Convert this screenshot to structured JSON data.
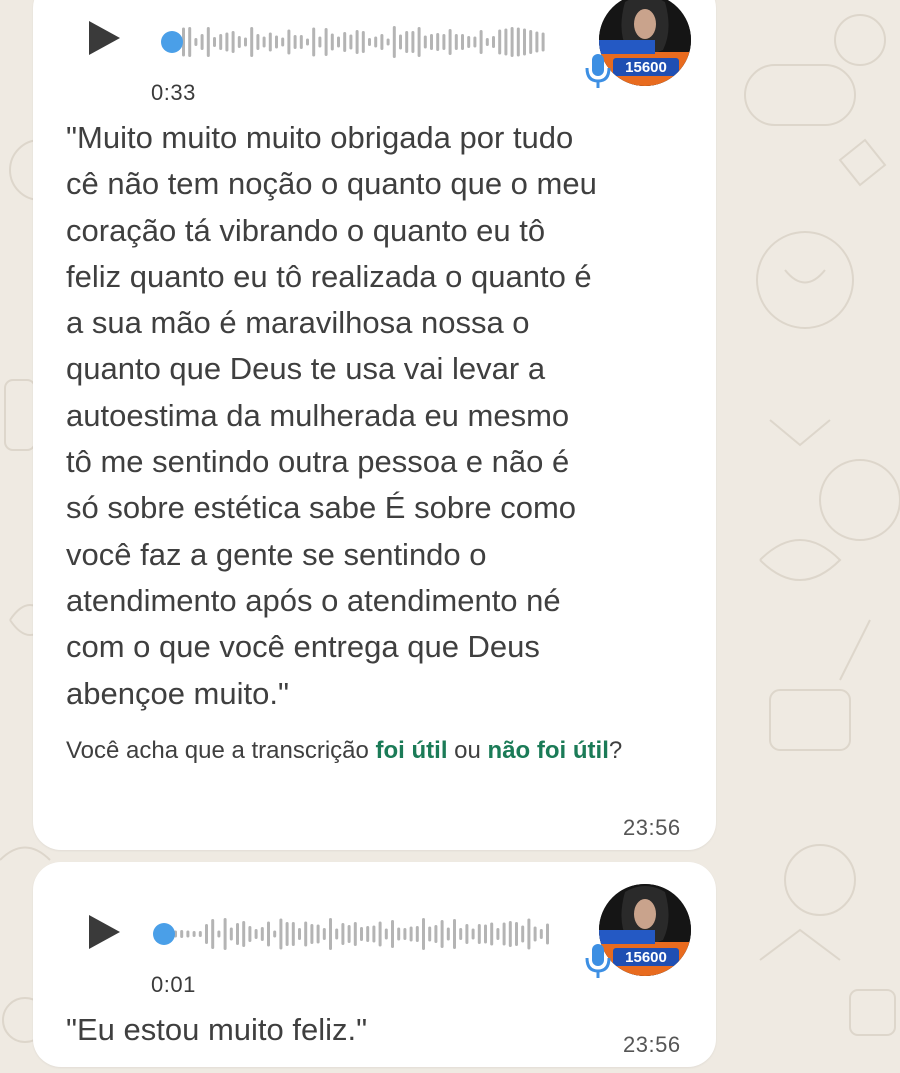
{
  "messages": [
    {
      "duration": "0:33",
      "progress": 0,
      "avatar_badge": "15600",
      "transcript": "\"Muito muito muito obrigada por tudo\ncê não tem noção o quanto que o meu\ncoração tá vibrando o quanto eu tô\nfeliz quanto eu tô realizada o quanto é\na sua mão é maravilhosa  nossa o\nquanto que Deus te usa vai levar a\nautoestima da mulherada eu mesmo\ntô me sentindo outra pessoa e não é\nsó sobre estética sabe  É sobre como\nvocê faz a gente se sentindo o\natendimento após o atendimento né\ncom o que você entrega que Deus\nabençoe muito.\"",
      "feedback": {
        "prefix": "Você acha que a transcrição ",
        "useful": "foi útil",
        "middle": " ou ",
        "not_useful": "não foi útil",
        "suffix": "?"
      },
      "time": "23:56"
    },
    {
      "duration": "0:01",
      "progress": 0,
      "avatar_badge": "15600",
      "transcript": "\"Eu estou muito feliz.\"",
      "time": "23:56"
    }
  ],
  "colors": {
    "background": "#efeae2",
    "bubble": "#ffffff",
    "waveform_played": "#4a9fe8",
    "waveform_unplayed": "#b4b4b4",
    "link": "#1b7b57",
    "mic": "#3d8fe3",
    "badge": "#1f4fb3"
  },
  "icons": {
    "play": "play-icon",
    "mic": "microphone-icon"
  }
}
